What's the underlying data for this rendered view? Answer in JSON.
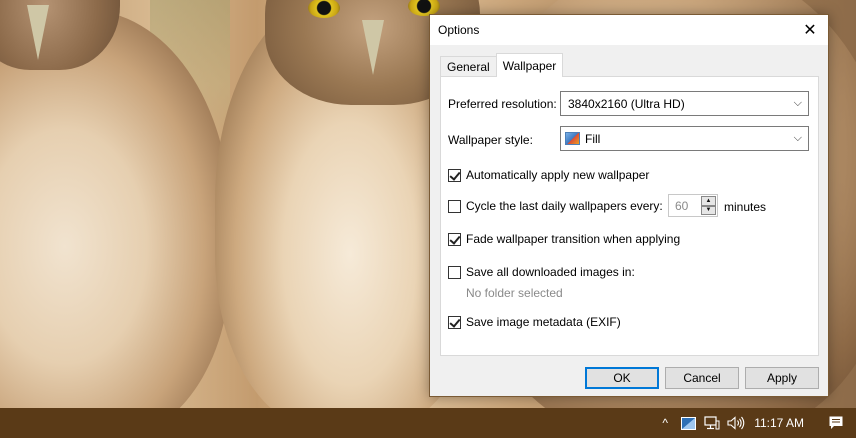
{
  "dialog": {
    "title": "Options",
    "close_glyph": "✕",
    "tabs": [
      {
        "label": "General",
        "active": false
      },
      {
        "label": "Wallpaper",
        "active": true
      }
    ],
    "preferred_resolution": {
      "label": "Preferred resolution:",
      "value": "3840x2160 (Ultra HD)"
    },
    "wallpaper_style": {
      "label": "Wallpaper style:",
      "value": "Fill",
      "icon": "fill-icon"
    },
    "auto_apply": {
      "label": "Automatically apply new wallpaper",
      "checked": true
    },
    "cycle": {
      "label": "Cycle the last daily wallpapers every:",
      "checked": false,
      "value": "60",
      "unit": "minutes"
    },
    "fade": {
      "label": "Fade wallpaper transition when applying",
      "checked": true
    },
    "save_images": {
      "label": "Save all downloaded images in:",
      "checked": false,
      "folder": "No folder selected"
    },
    "save_metadata": {
      "label": "Save image metadata (EXIF)",
      "checked": true
    },
    "buttons": {
      "ok": "OK",
      "cancel": "Cancel",
      "apply": "Apply"
    }
  },
  "taskbar": {
    "chevron": "^",
    "clock": "11:17 AM",
    "icons": [
      "app-tray-icon",
      "network-icon",
      "volume-icon",
      "action-center-icon"
    ],
    "accent": "#5a3a17"
  }
}
